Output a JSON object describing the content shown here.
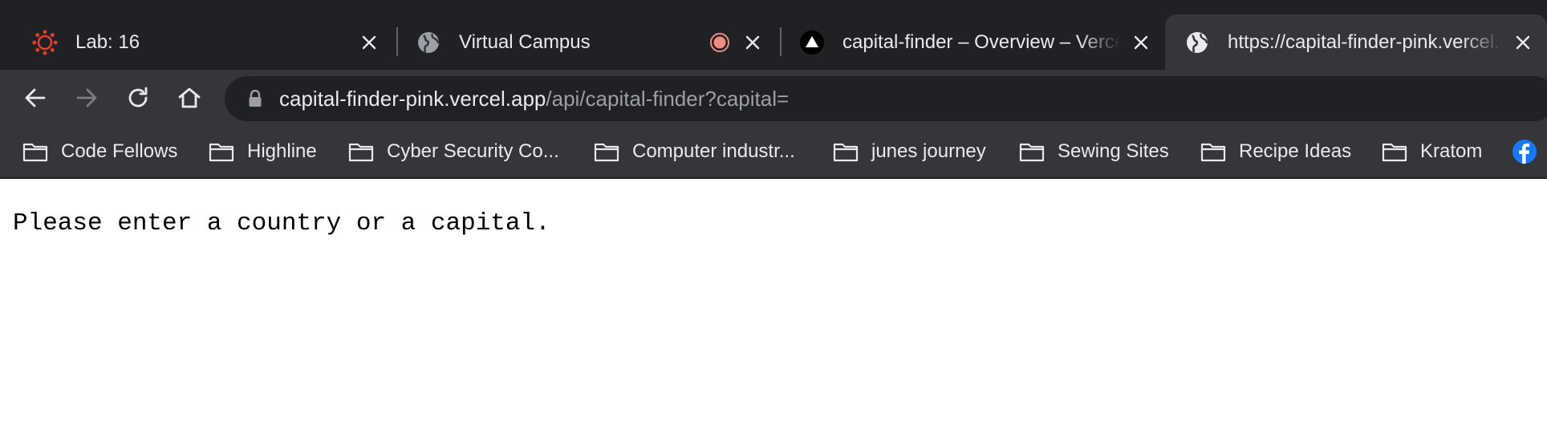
{
  "tabs": [
    {
      "title": "Lab: 16",
      "icon": "canvas-logo-icon",
      "active": false
    },
    {
      "title": "Virtual Campus",
      "icon": "globe-icon",
      "recording": true,
      "active": false
    },
    {
      "title": "capital-finder – Overview – Vercel",
      "icon": "vercel-logo-icon",
      "active": false
    },
    {
      "title": "https://capital-finder-pink.vercel.app/api/capital-finder?capital=",
      "icon": "globe-icon",
      "active": true
    }
  ],
  "toolbar": {
    "url_host": "capital-finder-pink.vercel.app",
    "url_path": "/api/capital-finder?capital="
  },
  "bookmarks": [
    {
      "label": "Code Fellows",
      "icon": "folder-icon"
    },
    {
      "label": "Highline",
      "icon": "folder-icon"
    },
    {
      "label": "Cyber Security Co...",
      "icon": "folder-icon"
    },
    {
      "label": "Computer industr...",
      "icon": "folder-icon"
    },
    {
      "label": "junes journey",
      "icon": "folder-icon"
    },
    {
      "label": "Sewing Sites",
      "icon": "folder-icon"
    },
    {
      "label": "Recipe Ideas",
      "icon": "folder-icon"
    },
    {
      "label": "Kratom",
      "icon": "folder-icon"
    },
    {
      "label": "",
      "icon": "facebook-icon"
    }
  ],
  "page": {
    "message": "Please enter a country or a capital."
  },
  "colors": {
    "tabstrip_bg": "#202124",
    "toolbar_bg": "#35363a",
    "omnibox_bg": "#202124",
    "text": "#e8eaed",
    "url_path": "#9aa0a6",
    "canvas_red": "#e13f2b",
    "recording_red": "#f28b82",
    "facebook_blue": "#1877f2"
  }
}
